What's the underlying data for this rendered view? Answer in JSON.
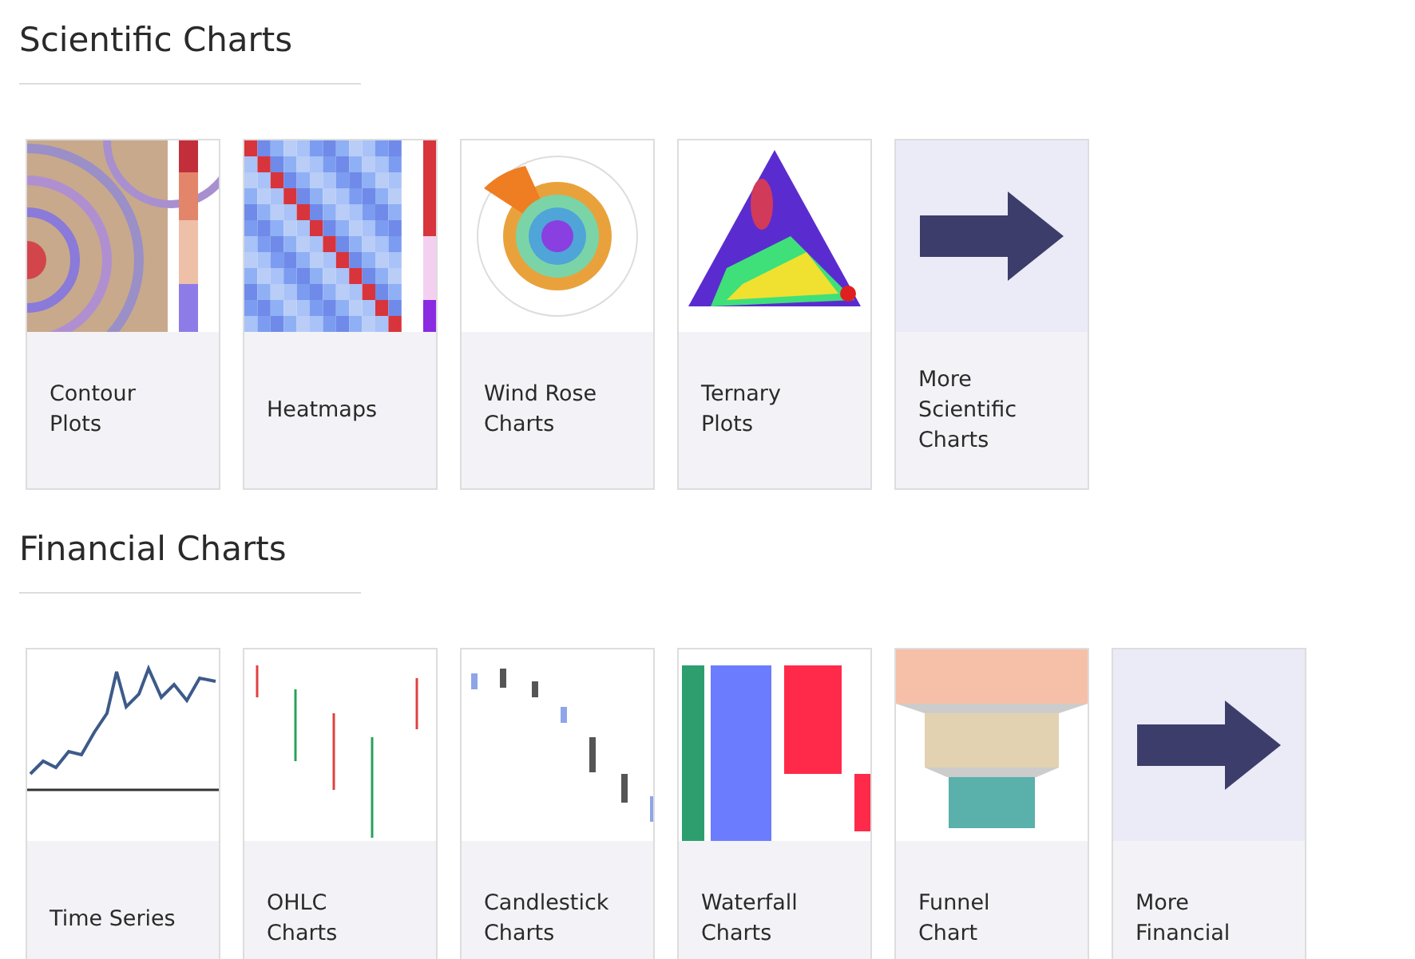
{
  "sections": [
    {
      "title": "Scientific Charts",
      "items": [
        {
          "label": "Contour Plots",
          "kind": "contour"
        },
        {
          "label": "Heatmaps",
          "kind": "heatmap"
        },
        {
          "label": "Wind Rose Charts",
          "kind": "windrose"
        },
        {
          "label": "Ternary Plots",
          "kind": "ternary"
        },
        {
          "label": "More Scientific Charts",
          "kind": "arrow"
        }
      ]
    },
    {
      "title": "Financial Charts",
      "items": [
        {
          "label": "Time Series",
          "kind": "timeseries"
        },
        {
          "label": "OHLC Charts",
          "kind": "ohlc"
        },
        {
          "label": "Candlestick Charts",
          "kind": "candlestick"
        },
        {
          "label": "Waterfall Charts",
          "kind": "waterfall"
        },
        {
          "label": "Funnel Chart",
          "kind": "funnel"
        },
        {
          "label": "More Financial",
          "kind": "arrow"
        }
      ]
    }
  ]
}
